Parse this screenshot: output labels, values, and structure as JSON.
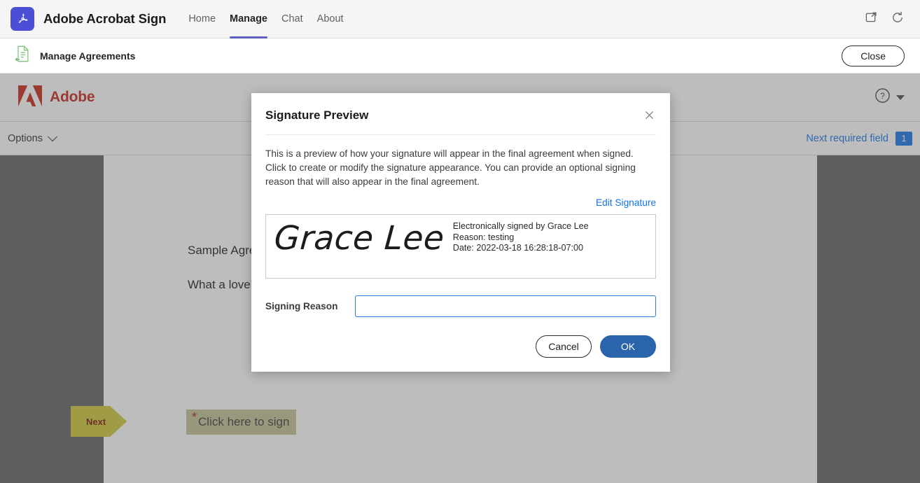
{
  "app_header": {
    "app_icon": "acrobat-icon",
    "title": "Adobe Acrobat Sign",
    "nav": [
      {
        "label": "Home",
        "active": false
      },
      {
        "label": "Manage",
        "active": true
      },
      {
        "label": "Chat",
        "active": false
      },
      {
        "label": "About",
        "active": false
      }
    ],
    "actions": [
      {
        "icon": "pop-out-icon"
      },
      {
        "icon": "refresh-icon"
      }
    ]
  },
  "subbar": {
    "icon": "agreement-document-icon",
    "title": "Manage Agreements",
    "close_label": "Close"
  },
  "sign_app": {
    "brand": "Adobe",
    "help_icon": "help-circle-icon",
    "options_label": "Options",
    "next_required_field_label": "Next required field",
    "next_required_field_count": "1",
    "document": {
      "title_line": "Sample Agreement",
      "body_line": "What a lovely day",
      "next_tag_label": "Next",
      "required_marker": "*",
      "click_here_label": "Click here to sign"
    }
  },
  "modal": {
    "title": "Signature Preview",
    "close_icon": "close-icon",
    "description": "This is a preview of how your signature will appear in the final agreement when signed. Click to create or modify the signature appearance. You can provide an optional signing reason that will also appear in the final agreement.",
    "edit_signature_label": "Edit Signature",
    "signature": {
      "name_script": "Grace Lee",
      "signed_by": "Electronically signed by Grace Lee",
      "reason": "Reason: testing",
      "date": "Date: 2022-03-18 16:28:18-07:00"
    },
    "signing_reason": {
      "label": "Signing Reason",
      "value": "",
      "placeholder": ""
    },
    "cancel_label": "Cancel",
    "ok_label": "OK"
  },
  "colors": {
    "teams_purple": "#4b4fd6",
    "adobe_red": "#c7241a",
    "link_blue": "#1473e6",
    "primary_button_blue": "#2a64ad",
    "tag_yellow": "#cfc637",
    "field_olive": "#c3c093",
    "required_red": "#b3261e"
  }
}
